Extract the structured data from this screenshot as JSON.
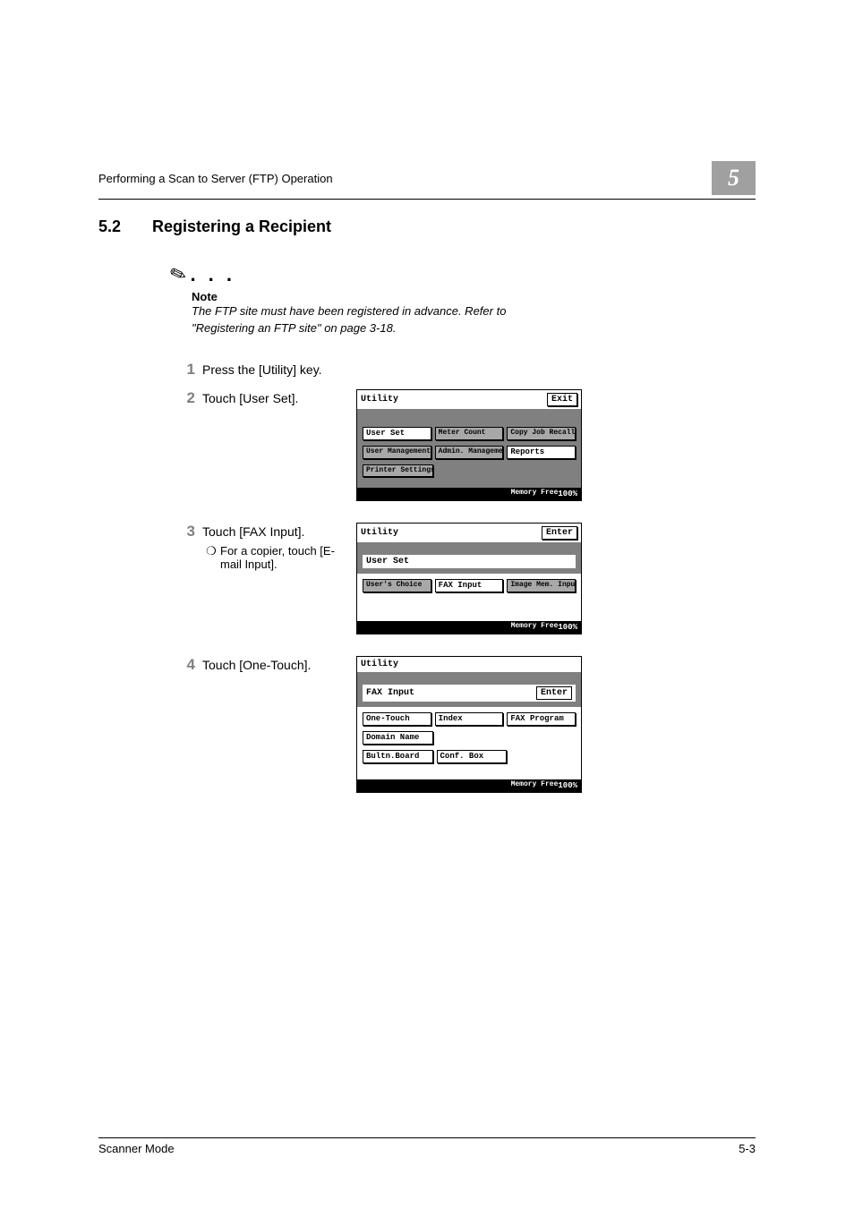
{
  "header": {
    "running": "Performing a Scan to Server (FTP) Operation",
    "chapter_number": "5"
  },
  "section": {
    "number": "5.2",
    "title": "Registering a Recipient"
  },
  "note": {
    "ellipsis": ". . .",
    "label": "Note",
    "body": "The FTP site must have been registered in advance. Refer to \"Registering an FTP site\" on page 3-18."
  },
  "steps": {
    "s1": {
      "num": "1",
      "text": "Press the [Utility] key."
    },
    "s2": {
      "num": "2",
      "text": "Touch [User Set]."
    },
    "s3": {
      "num": "3",
      "text": "Touch [FAX Input].",
      "sub_bullet": "❍",
      "sub": "For a copier, touch [E-mail Input]."
    },
    "s4": {
      "num": "4",
      "text": "Touch [One-Touch]."
    }
  },
  "lcd1": {
    "title": "Utility",
    "exit": "Exit",
    "user_set": "User Set",
    "meter_count": "Meter Count",
    "copy_job": "Copy Job Recall",
    "user_mgmt": "User Management",
    "admin_mgmt": "Admin. Management",
    "reports": "Reports",
    "printer_settings": "Printer Settings",
    "mem_label": "Memory Free",
    "mem_pct": "100%"
  },
  "lcd2": {
    "title": "Utility",
    "enter": "Enter",
    "user_set": "User Set",
    "users_choice": "User's Choice",
    "fax_input": "FAX Input",
    "image_mem": "Image Mem. Input",
    "mem_label": "Memory Free",
    "mem_pct": "100%"
  },
  "lcd3": {
    "title": "Utility",
    "fax_input": "FAX Input",
    "enter": "Enter",
    "one_touch": "One-Touch",
    "index": "Index",
    "fax_program": "FAX Program",
    "domain_name": "Domain Name",
    "bultn_board": "Bultn.Board",
    "conf_box": "Conf. Box",
    "mem_label": "Memory Free",
    "mem_pct": "100%"
  },
  "footer": {
    "left": "Scanner Mode",
    "right": "5-3"
  }
}
